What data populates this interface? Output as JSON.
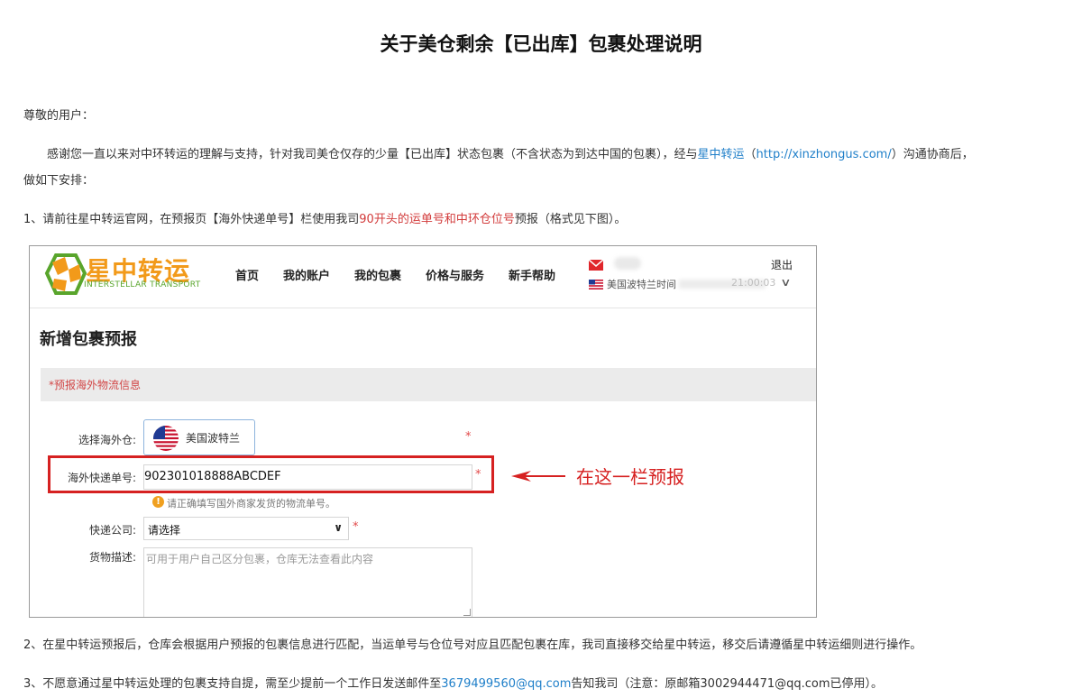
{
  "doc": {
    "title": "关于美仓剩余【已出库】包裹处理说明",
    "greeting": "尊敬的用户：",
    "intro": {
      "part1": "感谢您一直以来对中环转运的理解与支持，针对我司美仓仅存的少量【已出库】状态包裹（不含状态为到达中国的包裹），经与",
      "link1": "星中转运",
      "part2": "（",
      "link2": "http://xinzhongus.com/",
      "part3": "）沟通协商后，",
      "line2": "做如下安排："
    },
    "step1": {
      "part1": "1、请前往星中转运官网，在预报页【海外快递单号】栏使用我司",
      "highlight": "90开头的运单号和中环仓位号",
      "part2": "预报（格式见下图）。"
    },
    "step2": "2、在星中转运预报后，仓库会根据用户预报的包裹信息进行匹配，当运单号与仓位号对应且匹配包裹在库，我司直接移交给星中转运，移交后请遵循星中转运细则进行操作。",
    "step3": {
      "part1": "3、不愿意通过星中转运处理的包裹支持自提，需至少提前一个工作日发送邮件至",
      "email": "3679499560@qq.com",
      "part2": "告知我司（注意：原邮箱3002944471@qq.com已停用）。"
    }
  },
  "screenshot": {
    "brand_cn": "星中转运",
    "brand_en": "INTERSTELLAR TRANSPORT",
    "nav": [
      "首页",
      "我的账户",
      "我的包裹",
      "价格与服务",
      "新手帮助"
    ],
    "logout": "退出",
    "time_label": "美国波特兰时间",
    "time_tail": "21:00:03",
    "page_title": "新增包裹预报",
    "section": "*预报海外物流信息",
    "warehouse_label": "选择海外仓:",
    "warehouse_value": "美国波特兰",
    "tracking_label": "海外快递单号:",
    "tracking_value": "902301018888ABCDEF",
    "tracking_hint": "请正确填写国外商家发货的物流单号。",
    "courier_label": "快递公司:",
    "courier_value": "请选择",
    "desc_label": "货物描述:",
    "desc_placeholder": "可用于用户自己区分包裹，仓库无法查看此内容",
    "required": "*",
    "hint_icon": "!",
    "chevron": "∨",
    "select_arrow": "∨",
    "annotation": "在这一栏预报"
  },
  "colors": {
    "brand_orange": "#f29a1a",
    "brand_green": "#59a52c",
    "highlight_red": "#d62121",
    "link_blue": "#1f7fc9"
  },
  "icons": [
    "logo-icon",
    "mail-icon",
    "us-flag-icon",
    "warning-icon",
    "arrow-left-icon"
  ]
}
